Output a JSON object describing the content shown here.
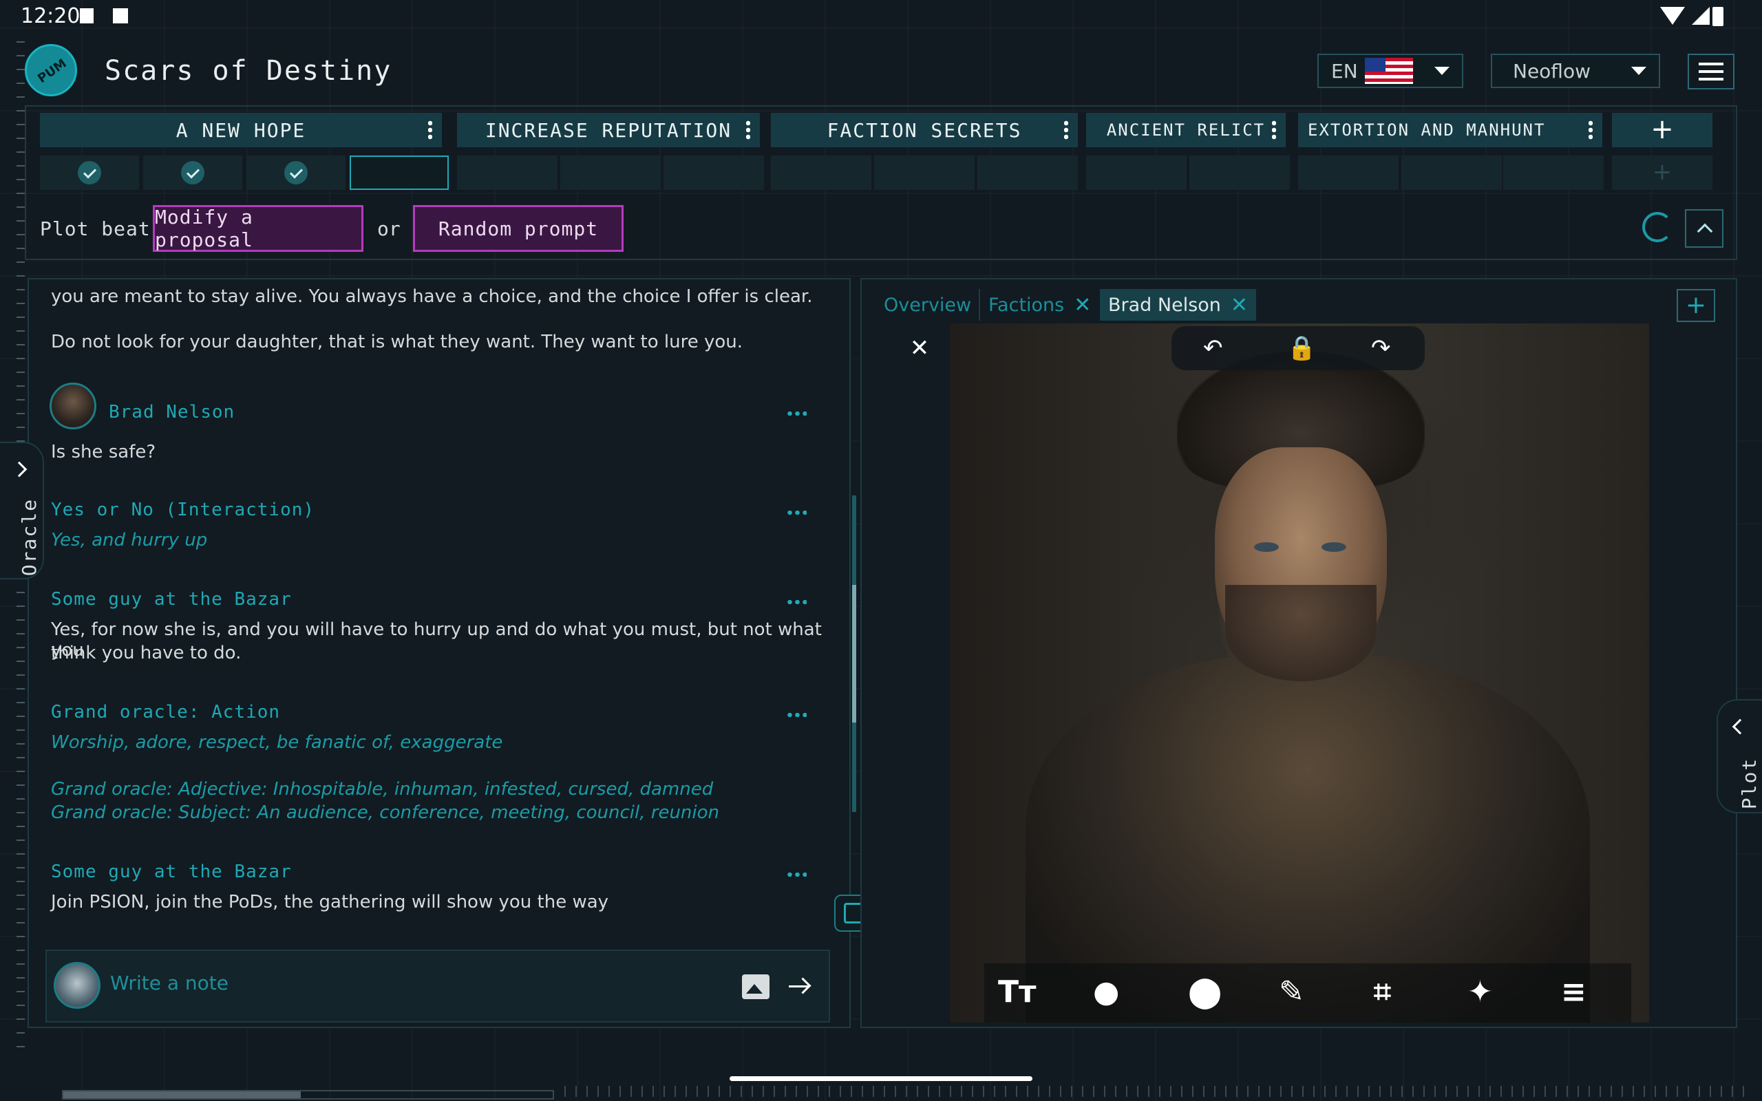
{
  "status": {
    "time": "12:20"
  },
  "app": {
    "title": "Scars of Destiny",
    "logo_text": "PUM"
  },
  "header": {
    "language": "EN",
    "theme": "Neoflow"
  },
  "beats": [
    {
      "label": "A NEW HOPE"
    },
    {
      "label": "INCREASE REPUTATION"
    },
    {
      "label": "FACTION SECRETS"
    },
    {
      "label": "ANCIENT RELICT"
    },
    {
      "label": "EXTORTION AND MANHUNT"
    }
  ],
  "add_beat": "+",
  "plot_beat": {
    "label": "Plot beat:",
    "modify": "Modify a proposal",
    "or": "or",
    "random": "Random prompt"
  },
  "chat": {
    "lines": [
      "you are meant to stay alive. You always have a choice, and the choice I offer is clear.",
      "Do not look for your daughter, that is what they want. They want to lure you."
    ],
    "entries": [
      {
        "name": "Brad Nelson",
        "text": "Is she safe?"
      },
      {
        "name": "Yes or No (Interaction)",
        "text": "Yes, and hurry up"
      },
      {
        "name": "Some guy at the Bazar",
        "text": "Yes, for now she is, and you will have to hurry up and do what you must, but not what you",
        "text2": "think you have to do."
      },
      {
        "name": "Grand oracle: Action",
        "text": "Worship, adore, respect, be fanatic of, exaggerate",
        "text2": "Grand oracle: Adjective: Inhospitable, inhuman, infested, cursed, damned",
        "text3": "Grand oracle: Subject: An audience, conference, meeting, council, reunion"
      },
      {
        "name": "Some guy at the Bazar",
        "text": "Join PSION, join the PoDs, the gathering will show you the way"
      }
    ],
    "note_placeholder": "Write a note"
  },
  "oracle_tab": "Oracle",
  "plot_tab": "Plot",
  "tabs": [
    {
      "label": "Overview"
    },
    {
      "label": "Factions"
    },
    {
      "label": "Brad Nelson"
    }
  ],
  "colors": {
    "accent": "#1fa8b5",
    "button_border": "#b43bbd",
    "background": "#121a21"
  }
}
